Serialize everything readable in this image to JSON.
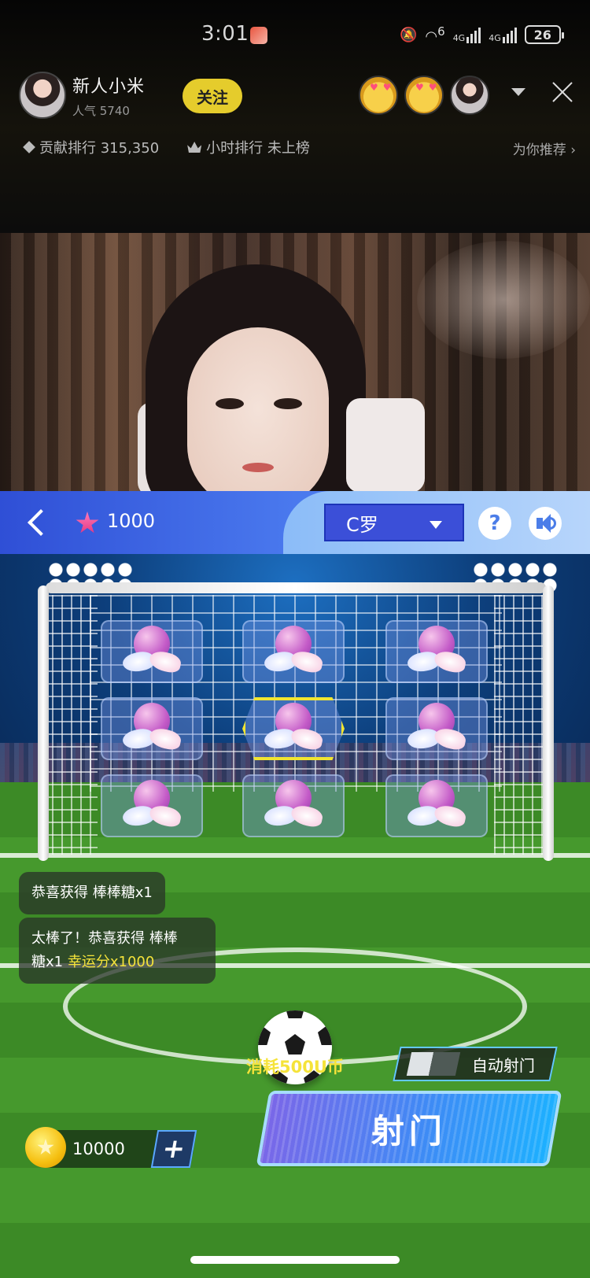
{
  "status_bar": {
    "time": "3:01",
    "signal_1": "4G",
    "signal_2": "4G",
    "wifi_sup": "6",
    "battery": "26"
  },
  "host": {
    "name": "新人小米",
    "popularity": "人气 5740",
    "follow_label": "关注"
  },
  "ranks": {
    "contribution": "贡献排行 315,350",
    "hourly": "小时排行 未上榜",
    "recommend": "为你推荐 ›"
  },
  "game": {
    "luck_points": "1000",
    "player_select": "C罗",
    "help_label": "?",
    "grid": [
      {
        "id": 1,
        "gift": "swan-balloon-icon",
        "selected": false
      },
      {
        "id": 2,
        "gift": "swan-balloon-icon",
        "selected": false
      },
      {
        "id": 3,
        "gift": "swan-balloon-icon",
        "selected": false
      },
      {
        "id": 4,
        "gift": "swan-balloon-icon",
        "selected": false
      },
      {
        "id": 5,
        "gift": "swan-balloon-icon",
        "selected": true
      },
      {
        "id": 6,
        "gift": "swan-balloon-icon",
        "selected": false
      },
      {
        "id": 7,
        "gift": "swan-balloon-icon",
        "selected": false
      },
      {
        "id": 8,
        "gift": "swan-balloon-icon",
        "selected": false
      },
      {
        "id": 9,
        "gift": "swan-balloon-icon",
        "selected": false
      }
    ],
    "messages": [
      {
        "text": "恭喜获得  棒棒糖x1"
      },
      {
        "text_1": "太棒了！恭喜获得 棒棒",
        "text_2": "糖x1",
        "highlight": "幸运分x1000"
      }
    ],
    "cost_label": "消耗500U币",
    "auto_shoot_label": "自动射门",
    "shoot_label": "射门",
    "coins": "10000",
    "add_label": "+"
  },
  "colors": {
    "accent_yellow": "#f5e33a",
    "follow_bg": "#e5cc2c",
    "topbar_blue": "#3b4fd8"
  }
}
